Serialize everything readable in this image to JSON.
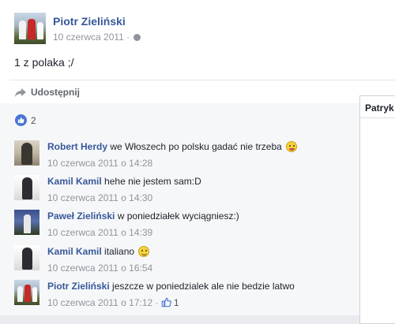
{
  "post": {
    "author": "Piotr Zieliński",
    "date": "10 czerwca 2011 ·",
    "text": "1 z polaka ;/"
  },
  "actions": {
    "share_label": "Udostępnij"
  },
  "reactions": {
    "count": "2"
  },
  "comments": [
    {
      "author": "Robert Herdy",
      "text": "we Włoszech po polsku gadać nie trzeba",
      "emoji": "tongue-emoji",
      "time": "10 czerwca 2011 o 14:28"
    },
    {
      "author": "Kamil Kamil",
      "text": "hehe nie jestem sam:D",
      "time": "10 czerwca 2011 o 14:30"
    },
    {
      "author": "Paweł Zieliński",
      "text": "w poniedziałek wyciągniesz:)",
      "time": "10 czerwca 2011 o 14:39"
    },
    {
      "author": "Kamil Kamil",
      "text": "italiano",
      "emoji": "smile-emoji",
      "time": "10 czerwca 2011 o 16:54"
    },
    {
      "author": "Piotr Zieliński",
      "text": "jeszcze w poniedzialek ale nie bedzie latwo",
      "time": "10 czerwca 2011 o 17:12 ·",
      "likes": "1"
    }
  ],
  "chat": {
    "title": "Patryk"
  },
  "colors": {
    "link": "#365899",
    "like_blue": "#4a76d3",
    "muted": "#90949c"
  }
}
